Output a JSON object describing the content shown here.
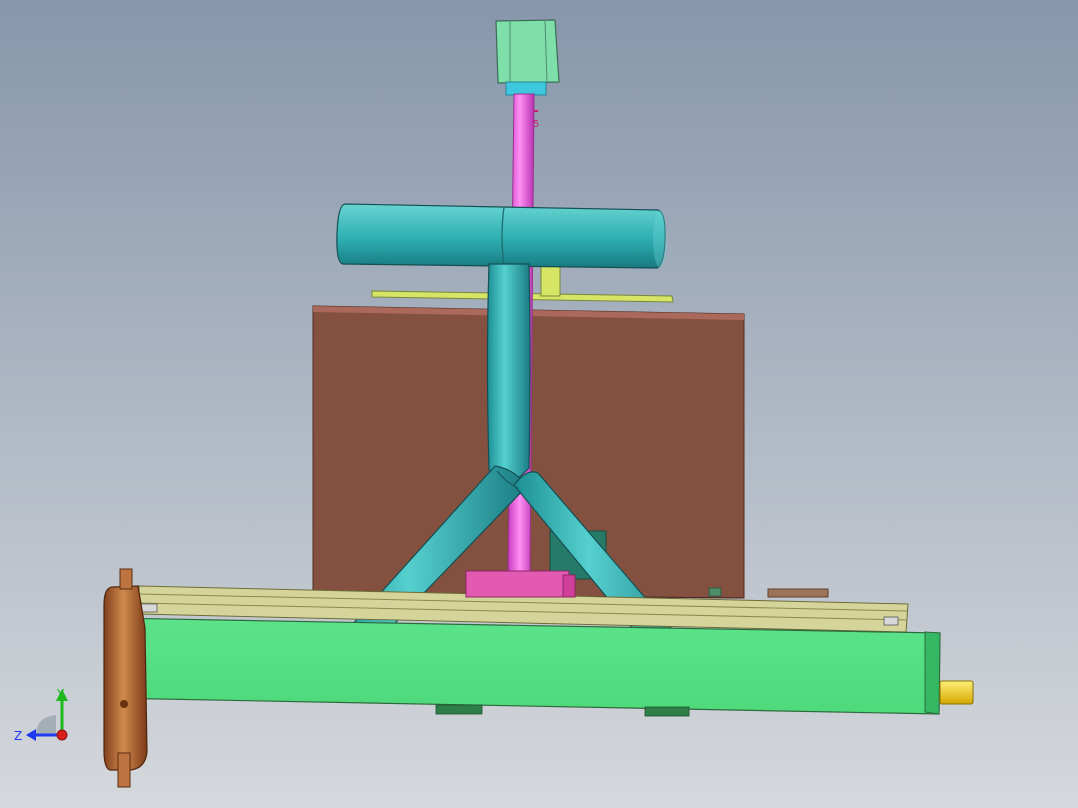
{
  "view": {
    "background_top": "#8796ab",
    "background_bottom": "#d5d8dc"
  },
  "model": {
    "colors": {
      "teal": "#2eaeb1",
      "magenta": "#e05cd6",
      "brown": "#845140",
      "rust": "#b96f3f",
      "green": "#55de82",
      "olive": "#d5d59b",
      "yellow_green": "#d4e36a",
      "gold": "#f0c40d",
      "mint": "#75d7a0",
      "blue_cap": "#2db4dc"
    }
  },
  "triad": {
    "y_label": "Y",
    "z_label": "Z",
    "y_color": "#1db81d",
    "z_color": "#1e39f2",
    "x_color": "#d91e1e"
  }
}
